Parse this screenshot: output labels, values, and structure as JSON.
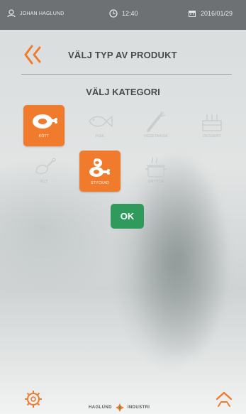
{
  "topbar": {
    "user_name": "JOHAN HAGLUND",
    "time": "12:40",
    "date": "2016/01/29",
    "icons": {
      "user": "user-icon",
      "clock": "clock-icon",
      "calendar": "calendar-icon"
    }
  },
  "header": {
    "title": "VÄLJ TYP AV PRODUKT",
    "back_icon": "back-chevron-icon"
  },
  "category_heading": "VÄLJ KATEGORI",
  "categories": [
    {
      "label": "KÖTT",
      "icon": "meat-icon",
      "selected": true
    },
    {
      "label": "FISK",
      "icon": "fish-icon",
      "selected": false
    },
    {
      "label": "VEGETARISK",
      "icon": "vegetarian-icon",
      "selected": false
    },
    {
      "label": "DESSERT",
      "icon": "dessert-icon",
      "selected": false
    },
    {
      "label": "VILT",
      "icon": "game-icon",
      "selected": false
    },
    {
      "label": "STYCKAD",
      "icon": "cut-meat-icon",
      "selected": true
    },
    {
      "label": "GRYTOR",
      "icon": "stew-pot-icon",
      "selected": false
    }
  ],
  "ok_label": "OK",
  "footer": {
    "brand_left": "HAGLUND",
    "brand_right": "INDUSTRI",
    "settings_icon": "settings-gear-icon",
    "up_icon": "up-chevron-icon"
  },
  "colors": {
    "accent": "#f07b2c",
    "ok_green": "#2f9a5c",
    "topbar": "#6d7173"
  }
}
